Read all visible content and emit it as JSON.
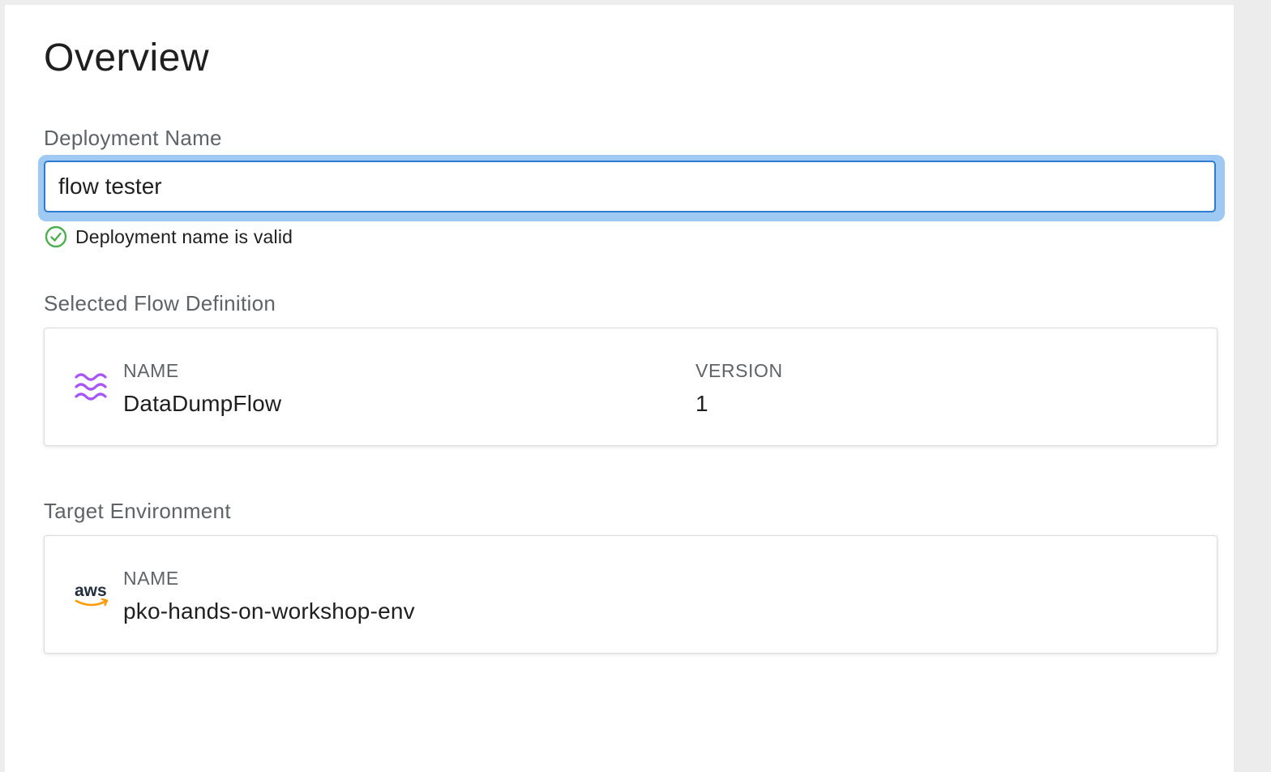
{
  "page": {
    "title": "Overview"
  },
  "deployment_name": {
    "label": "Deployment Name",
    "value": "flow tester",
    "validation_message": "Deployment name is valid",
    "validation_color": "#4caf50",
    "focus_color": "#2f7bd1"
  },
  "flow_definition": {
    "section_label": "Selected Flow Definition",
    "icon": "waves-icon",
    "icon_color": "#a855f7",
    "name_header": "NAME",
    "name_value": "DataDumpFlow",
    "version_header": "VERSION",
    "version_value": "1"
  },
  "target_environment": {
    "section_label": "Target Environment",
    "icon": "aws-logo-icon",
    "logo_text": "aws",
    "logo_smile_color": "#ff9900",
    "name_header": "NAME",
    "name_value": "pko-hands-on-workshop-env"
  }
}
